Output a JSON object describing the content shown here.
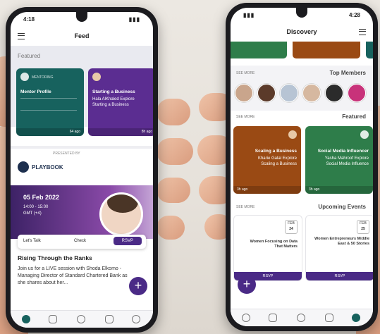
{
  "left_phone": {
    "status_time": "4:18",
    "title": "Feed",
    "section_featured": "Featured",
    "card1": {
      "title": "Mentor Profile",
      "tag": "MENTORING",
      "footer": "64 ago"
    },
    "card2": {
      "title": "Starting a Business",
      "line2": "Hala AlKhaled Explore",
      "line3": "Starting a Business",
      "footer": "8h ago"
    },
    "presented_by": "PRESENTED BY",
    "partner_logo": "PLAYBOOK",
    "event_date": "05 Feb 2022",
    "event_time": "14:00 - 15:00",
    "event_tz": "GMT (+4)",
    "actions": [
      "Let's Talk",
      "Check",
      "RSVP"
    ],
    "post_title": "Rising Through the Ranks",
    "post_body": "Join us for a LIVE session with Shoda Elkomo - Managing Director of Standard Chartered Bank as she shares about her...",
    "fab": "+"
  },
  "right_phone": {
    "status_time": "4:28",
    "title": "Discovery",
    "section_members": "Top Members",
    "see_more": "SEE MORE",
    "section_featured": "Featured",
    "card_brown": {
      "line1": "Scaling a Business",
      "line2": "Kharie Galal Explore",
      "line3": "Scaling a Business",
      "footer": "3h ago"
    },
    "card_green": {
      "line1": "Social Media Influencer",
      "line2": "Yasha Mahroof Explore",
      "line3": "Social Media Influence",
      "footer": "3h ago"
    },
    "section_events": "Upcoming Events",
    "event1": {
      "month": "FEB",
      "day": "24",
      "title": "Women Focusing on Data That Matters",
      "cta": "RSVP"
    },
    "event2": {
      "month": "FEB",
      "day": "25",
      "title": "Women Entrepreneurs Middle East & 50 Stories",
      "cta": "RSVP"
    },
    "fab": "+"
  }
}
